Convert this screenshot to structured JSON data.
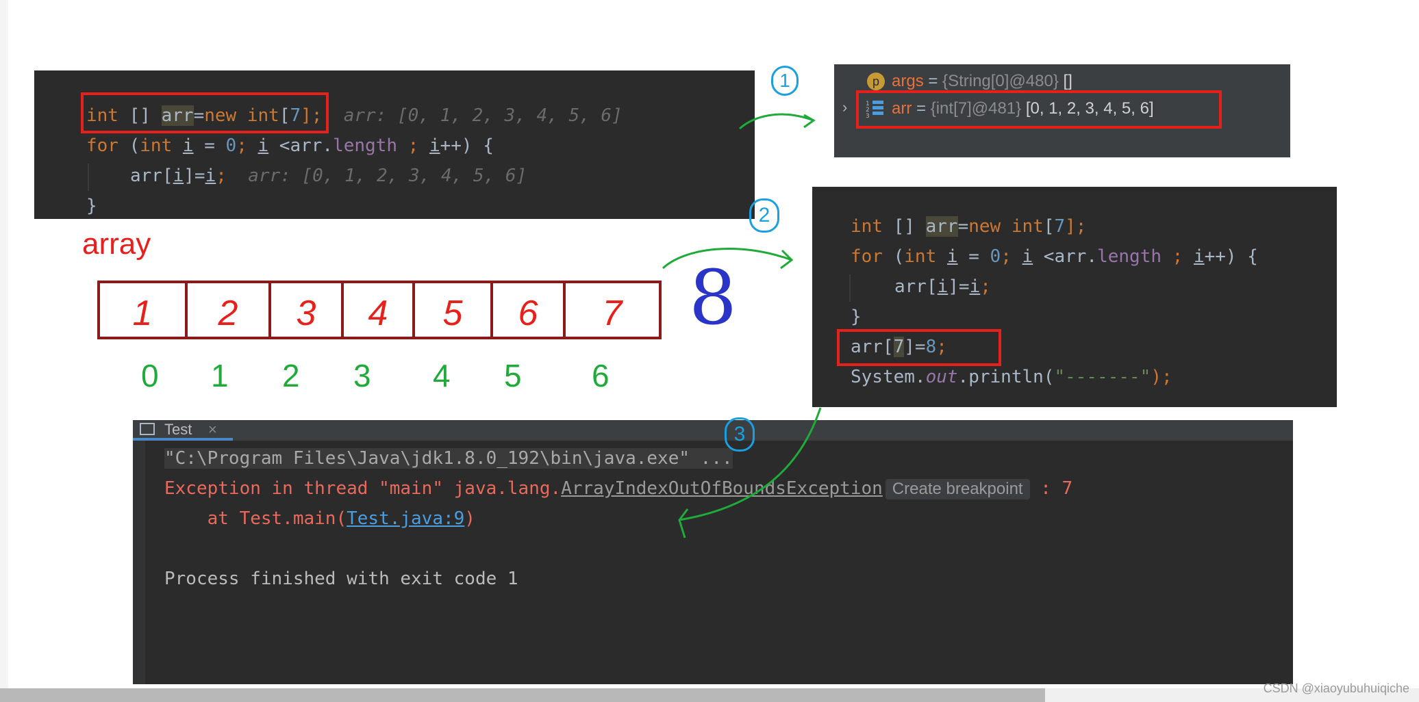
{
  "code_snippet_1": {
    "line1": {
      "kw1": "int",
      "sp1": " [] ",
      "var": "arr",
      "eq": "=",
      "kw2": "new",
      "sp2": " ",
      "kw3": "int",
      "br": "[",
      "num": "7",
      "end": "];",
      "hint": "arr: [0, 1, 2, 3, 4, 5, 6]"
    },
    "line2": {
      "kw": "for",
      "p1": " (",
      "kw2": "int",
      "sp": " ",
      "i1": "i",
      "p2": " = ",
      "zero": "0",
      "p3": "; ",
      "i2": "i",
      "p4": " <arr.",
      "len": "length",
      "p5": " ; ",
      "i3": "i",
      "p6": "++) {"
    },
    "line3": {
      "a": "arr[",
      "i1": "i",
      "b": "]=",
      "i2": "i",
      "c": ";",
      "hint": "arr: [0, 1, 2, 3, 4, 5, 6]"
    },
    "line4": "}"
  },
  "variables_panel": {
    "args": {
      "badge": "p",
      "name": "args",
      "eq": " = ",
      "type": "{String[0]@480}",
      "value": " []"
    },
    "arr": {
      "name": "arr",
      "eq": " = ",
      "type": "{int[7]@481}",
      "value": " [0, 1, 2, 3, 4, 5, 6]"
    }
  },
  "code_snippet_2": {
    "line1": {
      "kw1": "int",
      "sp1": " [] ",
      "var": "arr",
      "eq": "=",
      "kw2": "new",
      "sp2": " ",
      "kw3": "int",
      "br": "[",
      "num": "7",
      "end": "];"
    },
    "line2": {
      "kw": "for",
      "p1": " (",
      "kw2": "int",
      "sp": " ",
      "i1": "i",
      "p2": " = ",
      "zero": "0",
      "p3": "; ",
      "i2": "i",
      "p4": " <arr.",
      "len": "length",
      "p5": " ; ",
      "i3": "i",
      "p6": "++) {"
    },
    "line3": {
      "a": "arr[",
      "i1": "i",
      "b": "]=",
      "i2": "i",
      "c": ";"
    },
    "line4": "}",
    "line5": {
      "a": "arr[",
      "idx": "7",
      "b": "]=",
      "num": "8",
      "c": ";"
    },
    "line6": {
      "a": "System.",
      "out": "out",
      "b": ".println(",
      "str": "\"-------\"",
      "c": ");"
    }
  },
  "console": {
    "tab": "Test",
    "cmd": "\"C:\\Program Files\\Java\\jdk1.8.0_192\\bin\\java.exe\" ...",
    "exc_prefix": "Exception in thread \"main\" java.lang.",
    "exc_class": "ArrayIndexOutOfBoundsException",
    "create_bp": "Create breakpoint",
    "exc_suffix": " : 7",
    "at_prefix": "    at Test.main(",
    "at_link": "Test.java:9",
    "at_suffix": ")",
    "finished": "Process finished with exit code 1"
  },
  "annotations": {
    "array_label": "array",
    "cells": [
      "1",
      "2",
      "3",
      "4",
      "5",
      "6",
      "7"
    ],
    "indices": [
      "0",
      "1",
      "2",
      "3",
      "4",
      "5",
      "6"
    ],
    "extra_value": "8",
    "step_marks": [
      "1",
      "2",
      "3"
    ]
  },
  "watermark": "CSDN @xiaoyubuhuiqiche",
  "colors": {
    "annotation_red": "#e8201c",
    "annotation_green": "#1faa3a",
    "annotation_blue": "#2a35c8",
    "annotation_cyan": "#1aa0e0"
  }
}
